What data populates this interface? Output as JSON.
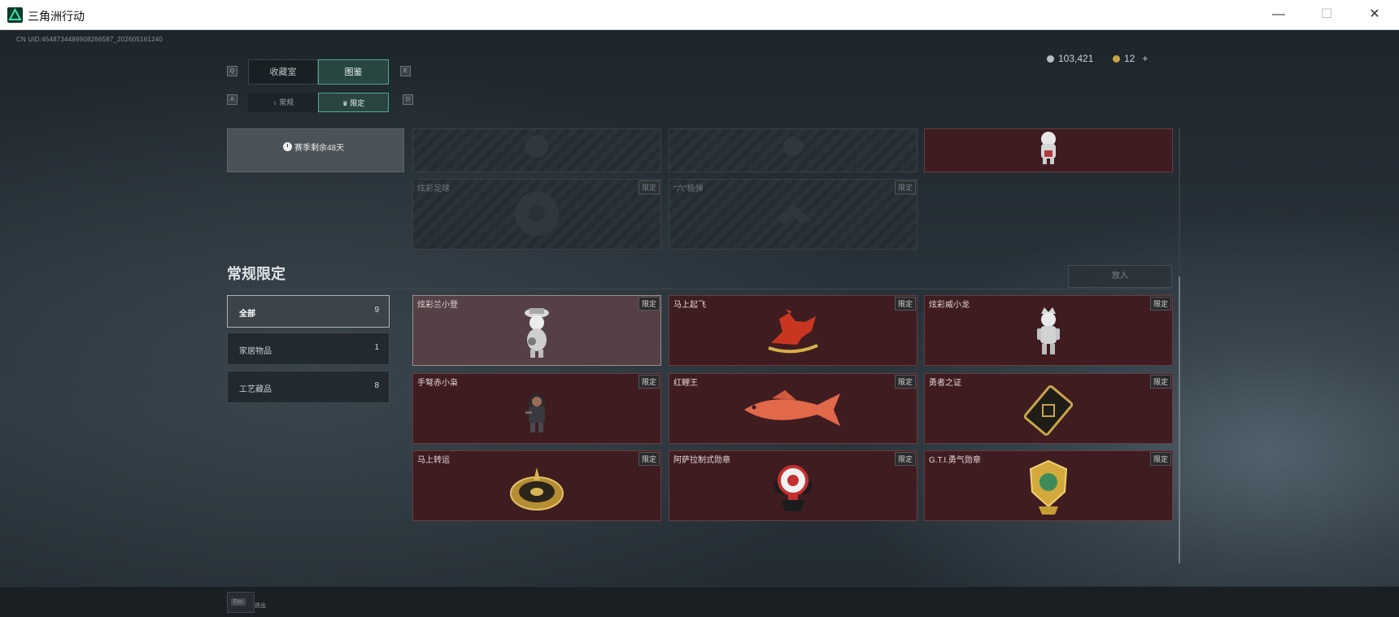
{
  "window": {
    "title": "三角洲行动",
    "minimize": "—",
    "maximize": "☐",
    "close": "✕"
  },
  "uid": "CN UID:4548734489908266587_202605161240",
  "currency": {
    "coins": "103,421",
    "tickets": "12",
    "plus": "+",
    "coin_color": "#b8c0c4",
    "ticket_color": "#c9a44a"
  },
  "tabs": {
    "left_key": "Q",
    "right_key": "E",
    "items": [
      {
        "label": "收藏室"
      },
      {
        "label": "图鉴",
        "active": true
      }
    ]
  },
  "subtabs": {
    "left_key": "A",
    "right_key": "D",
    "items": [
      {
        "label": "常规",
        "icon": "flame-icon"
      },
      {
        "label": "限定",
        "icon": "crown-icon",
        "active": true
      }
    ]
  },
  "season": {
    "remaining": "赛季剩余48天"
  },
  "upper_items": [
    {
      "name": "炫彩足球",
      "badge": "限定",
      "locked": true
    },
    {
      "name": "“六”极弹",
      "badge": "限定",
      "locked": true
    }
  ],
  "section": {
    "title": "常规限定",
    "place_button": "放入"
  },
  "categories": [
    {
      "label": "全部",
      "count": "9",
      "active": true
    },
    {
      "label": "家居物品",
      "count": "1"
    },
    {
      "label": "工艺藏品",
      "count": "8"
    }
  ],
  "items": [
    {
      "name": "炫彩兰小登",
      "badge": "限定",
      "icon": "figurine-icon",
      "selected": true
    },
    {
      "name": "马上起飞",
      "badge": "限定",
      "icon": "horse-icon"
    },
    {
      "name": "炫彩威小龙",
      "badge": "限定",
      "icon": "dragon-figurine-icon"
    },
    {
      "name": "手弩赤小枭",
      "badge": "限定",
      "icon": "hooded-figure-icon"
    },
    {
      "name": "红鲤王",
      "badge": "限定",
      "icon": "fish-icon"
    },
    {
      "name": "勇者之证",
      "badge": "限定",
      "icon": "card-icon"
    },
    {
      "name": "马上转运",
      "badge": "限定",
      "icon": "wheel-icon"
    },
    {
      "name": "阿萨拉制式勋章",
      "badge": "限定",
      "icon": "wing-medal-icon"
    },
    {
      "name": "G.T.I.勇气勋章",
      "badge": "限定",
      "icon": "shield-medal-icon"
    }
  ],
  "footer": {
    "esc_key": "Esc",
    "exit_label": "退出"
  }
}
